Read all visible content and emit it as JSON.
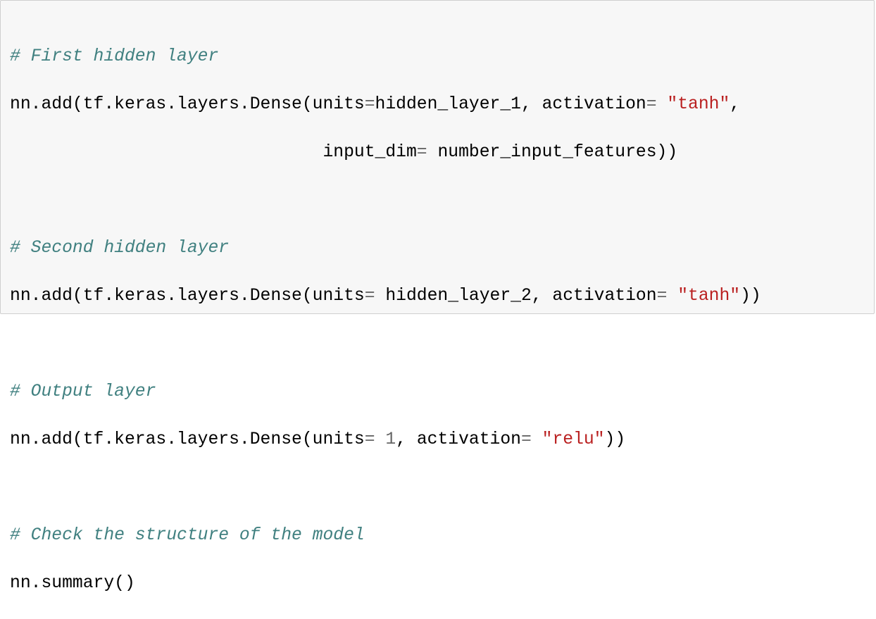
{
  "comments": {
    "first": "# First hidden layer",
    "second": "# Second hidden layer",
    "output": "# Output layer",
    "check": "# Check the structure of the model"
  },
  "lines": {
    "l2_a": "nn.add(tf.keras.layers.Dense(units",
    "l2_b": "hidden_layer_1, activation",
    "l2_c": " ",
    "l2_str": "\"tanh\"",
    "l2_d": ",",
    "l3_indent": "                              ",
    "l3_a": "input_dim",
    "l3_b": " number_input_features))",
    "l6_a": "nn.add(tf.keras.layers.Dense(units",
    "l6_b": " hidden_layer_2, activation",
    "l6_c": " ",
    "l6_str": "\"tanh\"",
    "l6_d": "))",
    "l9_a": "nn.add(tf.keras.layers.Dense(units",
    "l9_num": " 1",
    "l9_b": ", activation",
    "l9_c": " ",
    "l9_str": "\"relu\"",
    "l9_d": "))",
    "l12": "nn.summary()"
  },
  "operators": {
    "eq": "="
  },
  "colors": {
    "comment": "#408080",
    "string": "#ba2121",
    "operator": "#666666",
    "background": "#f7f7f7"
  }
}
